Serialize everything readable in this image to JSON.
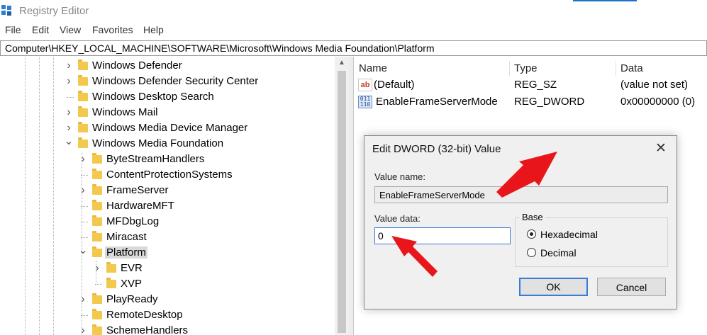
{
  "window": {
    "title": "Registry Editor"
  },
  "menu": [
    "File",
    "Edit",
    "View",
    "Favorites",
    "Help"
  ],
  "address": "Computer\\HKEY_LOCAL_MACHINE\\SOFTWARE\\Microsoft\\Windows Media Foundation\\Platform",
  "tree": [
    {
      "label": "Windows Defender",
      "expander": "collapsed"
    },
    {
      "label": "Windows Defender Security Center",
      "expander": "collapsed"
    },
    {
      "label": "Windows Desktop Search",
      "expander": "none"
    },
    {
      "label": "Windows Mail",
      "expander": "collapsed"
    },
    {
      "label": "Windows Media Device Manager",
      "expander": "collapsed"
    },
    {
      "label": "Windows Media Foundation",
      "expander": "expanded"
    },
    {
      "label": "ByteStreamHandlers",
      "expander": "collapsed"
    },
    {
      "label": "ContentProtectionSystems",
      "expander": "none"
    },
    {
      "label": "FrameServer",
      "expander": "collapsed"
    },
    {
      "label": "HardwareMFT",
      "expander": "none"
    },
    {
      "label": "MFDbgLog",
      "expander": "none"
    },
    {
      "label": "Miracast",
      "expander": "none"
    },
    {
      "label": "Platform",
      "expander": "expanded",
      "selected": true
    },
    {
      "label": "EVR",
      "expander": "collapsed"
    },
    {
      "label": "XVP",
      "expander": "none"
    },
    {
      "label": "PlayReady",
      "expander": "collapsed"
    },
    {
      "label": "RemoteDesktop",
      "expander": "none"
    },
    {
      "label": "SchemeHandlers",
      "expander": "collapsed"
    }
  ],
  "list": {
    "headers": {
      "name": "Name",
      "type": "Type",
      "data": "Data"
    },
    "rows": [
      {
        "icon": "string-value-icon",
        "icon_text": "ab",
        "name": "(Default)",
        "type": "REG_SZ",
        "data": "(value not set)"
      },
      {
        "icon": "binary-value-icon",
        "icon_text": "011 110",
        "name": "EnableFrameServerMode",
        "type": "REG_DWORD",
        "data": "0x00000000 (0)"
      }
    ]
  },
  "dialog": {
    "title": "Edit DWORD (32-bit) Value",
    "value_name_label": "Value name:",
    "value_name": "EnableFrameServerMode",
    "value_data_label": "Value data:",
    "value_data": "0",
    "base_label": "Base",
    "radio_hex": "Hexadecimal",
    "radio_dec": "Decimal",
    "base_selected": "Hexadecimal",
    "ok": "OK",
    "cancel": "Cancel",
    "close_glyph": "✕"
  },
  "colors": {
    "annotation_arrow": "#e8161b",
    "selection": "#d9d9d9",
    "focus": "#3a7bd5"
  }
}
